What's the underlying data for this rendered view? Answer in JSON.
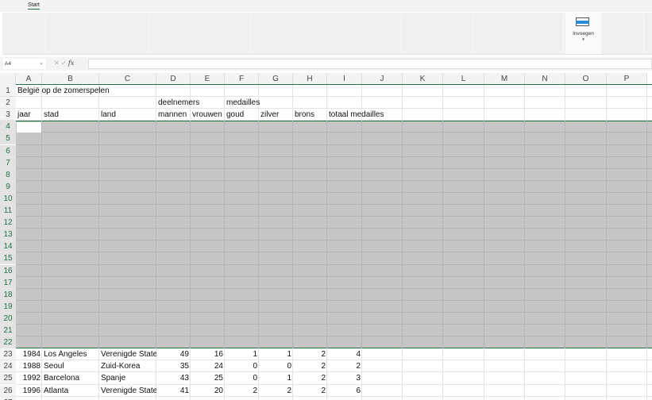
{
  "ribbon": {
    "tab": "Start",
    "insert_label": "Invoegen",
    "insert_caret": "▾"
  },
  "formula_bar": {
    "name_box": "A4",
    "name_caret": "⌄",
    "cancel": "✕",
    "confirm": "✓",
    "fx": "fx",
    "value": ""
  },
  "columns": [
    "A",
    "B",
    "C",
    "D",
    "E",
    "F",
    "G",
    "H",
    "I",
    "J",
    "K",
    "L",
    "M",
    "N",
    "O",
    "P"
  ],
  "rows": [
    1,
    2,
    3,
    4,
    5,
    6,
    7,
    8,
    9,
    10,
    11,
    12,
    13,
    14,
    15,
    16,
    17,
    18,
    19,
    20,
    21,
    22,
    23,
    24,
    25,
    26,
    27
  ],
  "selected_rows": [
    4,
    22
  ],
  "cells": [
    {
      "r": 1,
      "c": 0,
      "v": "België op de zomerspelen"
    },
    {
      "r": 2,
      "c": 3,
      "v": "deelnemers"
    },
    {
      "r": 2,
      "c": 5,
      "v": "medailles"
    },
    {
      "r": 3,
      "c": 0,
      "v": "jaar"
    },
    {
      "r": 3,
      "c": 1,
      "v": "stad"
    },
    {
      "r": 3,
      "c": 2,
      "v": "land"
    },
    {
      "r": 3,
      "c": 3,
      "v": "mannen",
      "clip": true
    },
    {
      "r": 3,
      "c": 4,
      "v": "vrouwen",
      "clip": true
    },
    {
      "r": 3,
      "c": 5,
      "v": "goud"
    },
    {
      "r": 3,
      "c": 6,
      "v": "zilver"
    },
    {
      "r": 3,
      "c": 7,
      "v": "brons"
    },
    {
      "r": 3,
      "c": 8,
      "v": "totaal medailles"
    },
    {
      "r": 23,
      "c": 0,
      "v": "1984",
      "n": true
    },
    {
      "r": 23,
      "c": 1,
      "v": "Los Angeles"
    },
    {
      "r": 23,
      "c": 2,
      "v": "Verenigde Staten",
      "clip": true
    },
    {
      "r": 23,
      "c": 3,
      "v": "49",
      "n": true
    },
    {
      "r": 23,
      "c": 4,
      "v": "16",
      "n": true
    },
    {
      "r": 23,
      "c": 5,
      "v": "1",
      "n": true
    },
    {
      "r": 23,
      "c": 6,
      "v": "1",
      "n": true
    },
    {
      "r": 23,
      "c": 7,
      "v": "2",
      "n": true
    },
    {
      "r": 23,
      "c": 8,
      "v": "4",
      "n": true
    },
    {
      "r": 24,
      "c": 0,
      "v": "1988",
      "n": true
    },
    {
      "r": 24,
      "c": 1,
      "v": "Seoul"
    },
    {
      "r": 24,
      "c": 2,
      "v": "Zuid-Korea"
    },
    {
      "r": 24,
      "c": 3,
      "v": "35",
      "n": true
    },
    {
      "r": 24,
      "c": 4,
      "v": "24",
      "n": true
    },
    {
      "r": 24,
      "c": 5,
      "v": "0",
      "n": true
    },
    {
      "r": 24,
      "c": 6,
      "v": "0",
      "n": true
    },
    {
      "r": 24,
      "c": 7,
      "v": "2",
      "n": true
    },
    {
      "r": 24,
      "c": 8,
      "v": "2",
      "n": true
    },
    {
      "r": 25,
      "c": 0,
      "v": "1992",
      "n": true
    },
    {
      "r": 25,
      "c": 1,
      "v": "Barcelona"
    },
    {
      "r": 25,
      "c": 2,
      "v": "Spanje"
    },
    {
      "r": 25,
      "c": 3,
      "v": "43",
      "n": true
    },
    {
      "r": 25,
      "c": 4,
      "v": "25",
      "n": true
    },
    {
      "r": 25,
      "c": 5,
      "v": "0",
      "n": true
    },
    {
      "r": 25,
      "c": 6,
      "v": "1",
      "n": true
    },
    {
      "r": 25,
      "c": 7,
      "v": "2",
      "n": true
    },
    {
      "r": 25,
      "c": 8,
      "v": "3",
      "n": true
    },
    {
      "r": 26,
      "c": 0,
      "v": "1996",
      "n": true
    },
    {
      "r": 26,
      "c": 1,
      "v": "Atlanta"
    },
    {
      "r": 26,
      "c": 2,
      "v": "Verenigde Staten",
      "clip": true
    },
    {
      "r": 26,
      "c": 3,
      "v": "41",
      "n": true
    },
    {
      "r": 26,
      "c": 4,
      "v": "20",
      "n": true
    },
    {
      "r": 26,
      "c": 5,
      "v": "2",
      "n": true
    },
    {
      "r": 26,
      "c": 6,
      "v": "2",
      "n": true
    },
    {
      "r": 26,
      "c": 7,
      "v": "2",
      "n": true
    },
    {
      "r": 26,
      "c": 8,
      "v": "6",
      "n": true
    }
  ]
}
